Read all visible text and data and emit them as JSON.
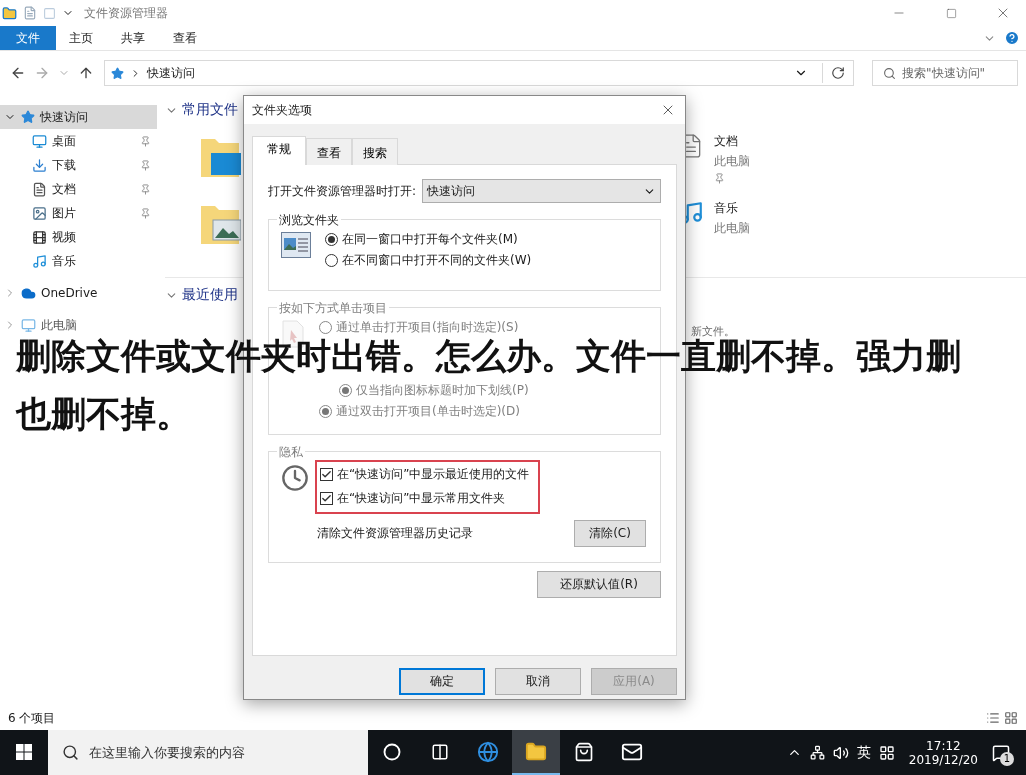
{
  "explorer": {
    "title": "文件资源管理器",
    "ribbon_tabs": [
      {
        "label": "文件",
        "selected": true
      },
      {
        "label": "主页",
        "selected": false
      },
      {
        "label": "共享",
        "selected": false
      },
      {
        "label": "查看",
        "selected": false
      }
    ],
    "address": {
      "path": "快速访问"
    },
    "search": {
      "placeholder": "搜索\"快速访问\""
    },
    "sidebar": [
      {
        "label": "快速访问",
        "kind": "star",
        "expanded": true,
        "selected": true,
        "children": [
          {
            "label": "桌面",
            "kind": "desktop",
            "pinned": true
          },
          {
            "label": "下载",
            "kind": "download",
            "pinned": true
          },
          {
            "label": "文档",
            "kind": "document",
            "pinned": true
          },
          {
            "label": "图片",
            "kind": "picture",
            "pinned": true
          },
          {
            "label": "视频",
            "kind": "video",
            "pinned": false
          },
          {
            "label": "音乐",
            "kind": "music",
            "pinned": false
          }
        ]
      },
      {
        "label": "OneDrive",
        "kind": "cloud",
        "expanded": false,
        "selected": false
      },
      {
        "label": "此电脑",
        "kind": "pc",
        "expanded": false,
        "selected": false
      }
    ],
    "frequent": {
      "title": "常用文件",
      "rows": [
        {
          "left": {
            "kind": "desktop"
          },
          "right": {
            "name": "文档",
            "location": "此电脑",
            "pinned": true,
            "kind": "document"
          }
        },
        {
          "left": {
            "kind": "picture"
          },
          "right": {
            "name": "音乐",
            "location": "此电脑",
            "pinned": false,
            "kind": "music"
          }
        }
      ]
    },
    "recent": {
      "title": "最近使用",
      "hint": "新文件。"
    },
    "status_bar": {
      "count": "6 个项目"
    }
  },
  "dialog": {
    "title": "文件夹选项",
    "tabs": [
      {
        "label": "常规",
        "selected": true
      },
      {
        "label": "查看",
        "selected": false
      },
      {
        "label": "搜索",
        "selected": false
      }
    ],
    "open_with": {
      "label": "打开文件资源管理器时打开:",
      "value": "快速访问"
    },
    "browse": {
      "title": "浏览文件夹",
      "disabled": false,
      "options": [
        {
          "label": "在同一窗口中打开每个文件夹(M)",
          "selected": true
        },
        {
          "label": "在不同窗口中打开不同的文件夹(W)",
          "selected": false
        }
      ]
    },
    "click": {
      "title": "按如下方式单击项目",
      "disabled": true,
      "options": [
        {
          "label": "通过单击打开项目(指向时选定)(S)",
          "selected": false,
          "children": [
            {
              "label": "仅当指向图标标题时加下划线(P)",
              "selected": true
            }
          ]
        },
        {
          "label": "通过双击打开项目(单击时选定)(D)",
          "selected": true
        }
      ]
    },
    "privacy": {
      "title": "隐私",
      "highlight": true,
      "checks": [
        {
          "label": "在“快速访问”中显示最近使用的文件",
          "checked": true
        },
        {
          "label": "在“快速访问”中显示常用文件夹",
          "checked": true
        }
      ],
      "clear_label": "清除文件资源管理器历史记录",
      "clear_button": "清除(C)"
    },
    "restore_button": "还原默认值(R)",
    "buttons": [
      {
        "label": "确定",
        "kind": "default",
        "disabled": false
      },
      {
        "label": "取消",
        "kind": "normal",
        "disabled": false
      },
      {
        "label": "应用(A)",
        "kind": "normal",
        "disabled": true
      }
    ]
  },
  "caption": {
    "lines": [
      "删除文件或文件夹时出错。怎么办。文件一直删不掉。强力删",
      "也删不掉。"
    ]
  },
  "taskbar": {
    "search_placeholder": "在这里输入你要搜索的内容",
    "apps": [
      {
        "kind": "cortana",
        "active": false
      },
      {
        "kind": "taskview",
        "active": false
      },
      {
        "kind": "browser",
        "active": false
      },
      {
        "kind": "explorer",
        "active": true
      },
      {
        "kind": "store",
        "active": false
      },
      {
        "kind": "mail",
        "active": false
      }
    ],
    "ime": "英",
    "time": "17:12",
    "date": "2019/12/20",
    "notifications": "1"
  }
}
